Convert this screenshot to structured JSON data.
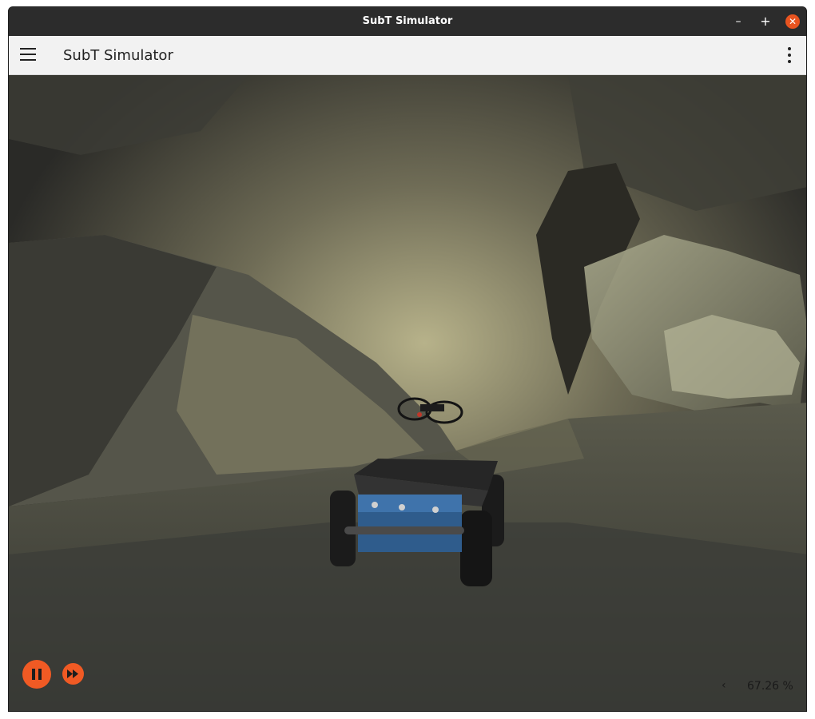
{
  "window": {
    "title": "SubT Simulator",
    "minimize_glyph": "–",
    "maximize_glyph": "+",
    "close_glyph": "✕"
  },
  "appbar": {
    "title": "SubT Simulator",
    "menu_icon": "hamburger-menu-icon",
    "more_icon": "more-vert-icon"
  },
  "scene": {
    "description_icons": [
      "cave-environment",
      "wheeled-robot",
      "drone"
    ]
  },
  "controls": {
    "pause_icon": "pause-icon",
    "fast_forward_icon": "fast-forward-icon",
    "expand_glyph": "‹"
  },
  "stats": {
    "real_time_factor": "67.26 %"
  },
  "colors": {
    "accent": "#f05a24",
    "titlebar": "#2c2c2c",
    "appbar": "#f2f2f2"
  }
}
